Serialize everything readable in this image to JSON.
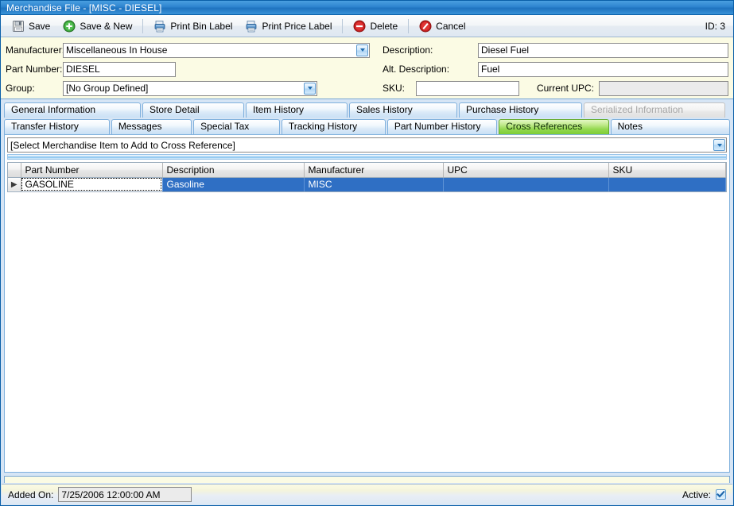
{
  "window": {
    "title": "Merchandise File - [MISC - DIESEL]"
  },
  "toolbar": {
    "save_label": "Save",
    "save_new_label": "Save & New",
    "print_bin_label": "Print Bin Label",
    "print_price_label": "Print Price Label",
    "delete_label": "Delete",
    "cancel_label": "Cancel",
    "id_label": "ID: 3"
  },
  "form": {
    "manufacturer_label": "Manufacturer:",
    "manufacturer_value": "Miscellaneous In House",
    "part_number_label": "Part Number:",
    "part_number_value": "DIESEL",
    "group_label": "Group:",
    "group_value": "[No Group Defined]",
    "description_label": "Description:",
    "description_value": "Diesel Fuel",
    "alt_description_label": "Alt. Description:",
    "alt_description_value": "Fuel",
    "sku_label": "SKU:",
    "sku_value": "",
    "current_upc_label": "Current UPC:",
    "current_upc_value": ""
  },
  "tabs": {
    "row1": [
      {
        "label": "General Information",
        "state": "normal"
      },
      {
        "label": "Store Detail",
        "state": "normal"
      },
      {
        "label": "Item History",
        "state": "normal"
      },
      {
        "label": "Sales History",
        "state": "normal"
      },
      {
        "label": "Purchase History",
        "state": "normal"
      },
      {
        "label": "Serialized Information",
        "state": "disabled"
      }
    ],
    "row2": [
      {
        "label": "Transfer History",
        "state": "normal"
      },
      {
        "label": "Messages",
        "state": "normal"
      },
      {
        "label": "Special Tax",
        "state": "normal"
      },
      {
        "label": "Tracking History",
        "state": "normal"
      },
      {
        "label": "Part Number History",
        "state": "normal"
      },
      {
        "label": "Cross References",
        "state": "active"
      },
      {
        "label": "Notes",
        "state": "normal"
      }
    ]
  },
  "cross_references": {
    "selector_value": "[Select Merchandise Item to Add to Cross Reference]",
    "columns": [
      "Part Number",
      "Description",
      "Manufacturer",
      "UPC",
      "SKU"
    ],
    "rows": [
      {
        "indicator": "▶",
        "part_number": "GASOLINE",
        "description": "Gasoline",
        "manufacturer": "MISC",
        "upc": "",
        "sku": ""
      }
    ]
  },
  "status": {
    "added_on_label": "Added On:",
    "added_on_value": "7/25/2006 12:00:00 AM",
    "active_label": "Active:",
    "active_checked": true
  },
  "colors": {
    "title_bar": "#2e84cf",
    "form_background": "#fbfbe4",
    "active_tab": "#93d84f",
    "selection": "#2f6fc4",
    "delete_red": "#cc2222",
    "save_new_green": "#2f9e2f"
  }
}
